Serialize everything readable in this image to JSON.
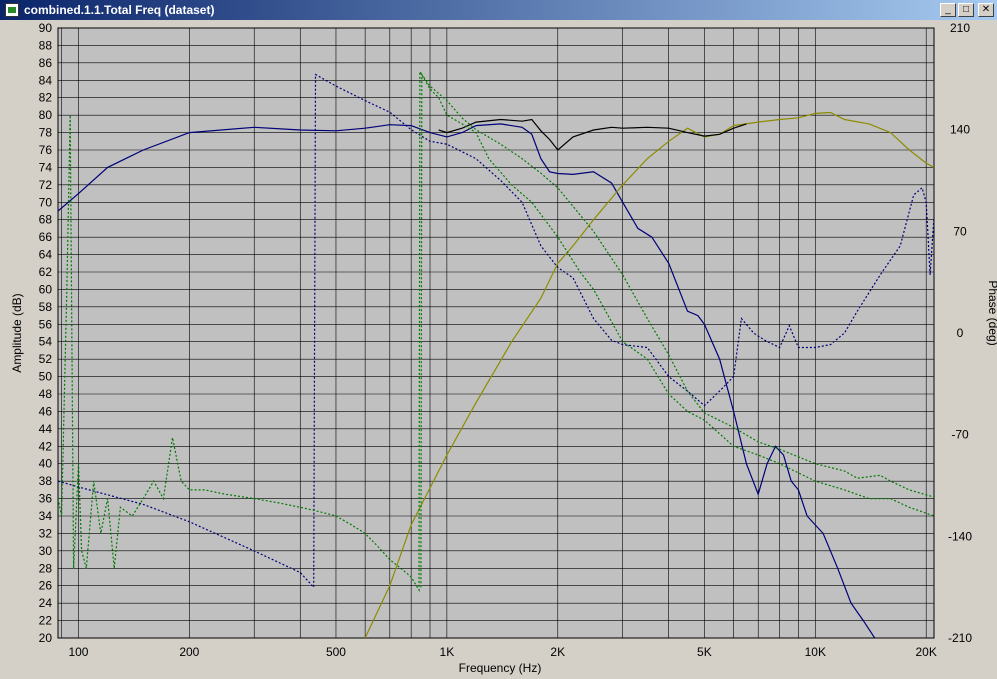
{
  "window": {
    "title": "combined.1.1.Total Freq (dataset)",
    "buttons": {
      "minimize": "_",
      "maximize": "□",
      "close": "✕"
    }
  },
  "colors": {
    "plot_bg": "#c0c0c0",
    "total_black": "#000000",
    "woofer_blue": "#00007a",
    "tweeter_olive": "#8c8c00",
    "sum_green": "#007a00"
  },
  "chart_data": {
    "type": "line",
    "title": "",
    "xlabel": "Frequency (Hz)",
    "ylabel": "Amplitude (dB)",
    "y2label": "Phase (deg)",
    "xscale": "log",
    "xlim": [
      88,
      21000
    ],
    "ylim": [
      20,
      90
    ],
    "y2lim": [
      -210,
      210
    ],
    "grid": true,
    "x_ticks": [
      {
        "v": 100,
        "label": "100"
      },
      {
        "v": 200,
        "label": "200"
      },
      {
        "v": 500,
        "label": "500"
      },
      {
        "v": 1000,
        "label": "1K"
      },
      {
        "v": 2000,
        "label": "2K"
      },
      {
        "v": 5000,
        "label": "5K"
      },
      {
        "v": 10000,
        "label": "10K"
      },
      {
        "v": 20000,
        "label": "20K"
      }
    ],
    "y_ticks": [
      "20",
      "22",
      "24",
      "26",
      "28",
      "30",
      "32",
      "34",
      "36",
      "38",
      "40",
      "42",
      "44",
      "46",
      "48",
      "50",
      "52",
      "54",
      "56",
      "58",
      "60",
      "62",
      "64",
      "66",
      "68",
      "70",
      "72",
      "74",
      "76",
      "78",
      "80",
      "82",
      "84",
      "86",
      "88",
      "90"
    ],
    "y2_ticks": [
      {
        "v": 210,
        "label": "210"
      },
      {
        "v": 140,
        "label": "140"
      },
      {
        "v": 70,
        "label": "70"
      },
      {
        "v": 0,
        "label": "0"
      },
      {
        "v": -70,
        "label": "-70"
      },
      {
        "v": -140,
        "label": "-140"
      },
      {
        "v": -210,
        "label": "-210"
      }
    ],
    "series": [
      {
        "key": "woofer_amp",
        "axis": "left",
        "color": "#00007a",
        "dash": false,
        "points": [
          [
            88,
            69
          ],
          [
            100,
            71
          ],
          [
            120,
            74
          ],
          [
            150,
            76
          ],
          [
            200,
            78
          ],
          [
            300,
            78.6
          ],
          [
            400,
            78.3
          ],
          [
            500,
            78.2
          ],
          [
            600,
            78.5
          ],
          [
            700,
            78.9
          ],
          [
            800,
            78.8
          ],
          [
            900,
            78
          ],
          [
            1000,
            77.5
          ],
          [
            1100,
            78
          ],
          [
            1200,
            78.8
          ],
          [
            1400,
            79
          ],
          [
            1600,
            78.6
          ],
          [
            1700,
            77.8
          ],
          [
            1800,
            75
          ],
          [
            1900,
            73.5
          ],
          [
            2000,
            73.3
          ],
          [
            2200,
            73.2
          ],
          [
            2500,
            73.5
          ],
          [
            2800,
            72.2
          ],
          [
            3000,
            70
          ],
          [
            3300,
            67
          ],
          [
            3600,
            66
          ],
          [
            4000,
            63
          ],
          [
            4500,
            57.5
          ],
          [
            4800,
            57
          ],
          [
            5000,
            56
          ],
          [
            5500,
            52
          ],
          [
            6000,
            46
          ],
          [
            6500,
            40
          ],
          [
            7000,
            36.5
          ],
          [
            7400,
            40
          ],
          [
            7800,
            42
          ],
          [
            8200,
            41
          ],
          [
            8600,
            38
          ],
          [
            9000,
            37
          ],
          [
            9500,
            34
          ],
          [
            10500,
            32
          ],
          [
            11500,
            28
          ],
          [
            12500,
            24
          ],
          [
            13500,
            22
          ],
          [
            14500,
            20
          ]
        ]
      },
      {
        "key": "woofer_phase",
        "axis": "right",
        "color": "#00007a",
        "dash": true,
        "points": [
          [
            88,
            -102
          ],
          [
            100,
            -106
          ],
          [
            150,
            -118
          ],
          [
            200,
            -130
          ],
          [
            300,
            -150
          ],
          [
            400,
            -165
          ],
          [
            435,
            -175
          ],
          [
            440,
            178
          ],
          [
            500,
            170
          ],
          [
            600,
            160
          ],
          [
            700,
            152
          ],
          [
            800,
            140
          ],
          [
            900,
            132
          ],
          [
            1000,
            130
          ],
          [
            1200,
            120
          ],
          [
            1400,
            105
          ],
          [
            1600,
            90
          ],
          [
            1800,
            60
          ],
          [
            2000,
            45
          ],
          [
            2200,
            38
          ],
          [
            2500,
            10
          ],
          [
            2800,
            -5
          ],
          [
            3000,
            -8
          ],
          [
            3500,
            -10
          ],
          [
            4000,
            -30
          ],
          [
            4500,
            -40
          ],
          [
            5000,
            -50
          ],
          [
            5500,
            -40
          ],
          [
            6000,
            -30
          ],
          [
            6300,
            10
          ],
          [
            6800,
            0
          ],
          [
            7300,
            -5
          ],
          [
            8000,
            -10
          ],
          [
            8500,
            5
          ],
          [
            9000,
            -10
          ],
          [
            10000,
            -10
          ],
          [
            11000,
            -8
          ],
          [
            12000,
            0
          ],
          [
            13000,
            15
          ],
          [
            15000,
            40
          ],
          [
            17000,
            60
          ],
          [
            18500,
            95
          ],
          [
            19500,
            100
          ],
          [
            20000,
            90
          ],
          [
            20500,
            40
          ],
          [
            21000,
            80
          ]
        ]
      },
      {
        "key": "tweeter_amp",
        "axis": "left",
        "color": "#8c8c00",
        "dash": false,
        "points": [
          [
            600,
            20
          ],
          [
            700,
            26
          ],
          [
            800,
            33
          ],
          [
            1000,
            41
          ],
          [
            1200,
            47
          ],
          [
            1500,
            54
          ],
          [
            1800,
            59
          ],
          [
            2000,
            63
          ],
          [
            2200,
            65
          ],
          [
            2500,
            68
          ],
          [
            3000,
            72
          ],
          [
            3500,
            75
          ],
          [
            4000,
            77
          ],
          [
            4500,
            78.5
          ],
          [
            5000,
            77.5
          ],
          [
            5500,
            77.8
          ],
          [
            6000,
            78.8
          ],
          [
            7000,
            79.2
          ],
          [
            8000,
            79.5
          ],
          [
            9000,
            79.7
          ],
          [
            10000,
            80.2
          ],
          [
            11000,
            80.3
          ],
          [
            12000,
            79.5
          ],
          [
            14000,
            79
          ],
          [
            16000,
            78
          ],
          [
            18000,
            76
          ],
          [
            20000,
            74.5
          ],
          [
            21000,
            74
          ]
        ]
      },
      {
        "key": "total_amp",
        "axis": "left",
        "color": "#000000",
        "dash": false,
        "points": [
          [
            950,
            78.3
          ],
          [
            1000,
            78
          ],
          [
            1100,
            78.5
          ],
          [
            1200,
            79.2
          ],
          [
            1400,
            79.5
          ],
          [
            1600,
            79.3
          ],
          [
            1700,
            79.5
          ],
          [
            1800,
            78.2
          ],
          [
            1900,
            77.2
          ],
          [
            2000,
            76
          ],
          [
            2200,
            77.5
          ],
          [
            2500,
            78.3
          ],
          [
            2800,
            78.6
          ],
          [
            3000,
            78.5
          ],
          [
            3500,
            78.6
          ],
          [
            4000,
            78.5
          ],
          [
            4500,
            78
          ],
          [
            5000,
            77.6
          ],
          [
            5500,
            77.8
          ],
          [
            6000,
            78.5
          ],
          [
            6500,
            79
          ]
        ]
      },
      {
        "key": "tweeter_phase",
        "axis": "right",
        "color": "#007a00",
        "dash": true,
        "points": [
          [
            850,
            -175
          ],
          [
            855,
            178
          ],
          [
            900,
            170
          ],
          [
            1000,
            160
          ],
          [
            1100,
            148
          ],
          [
            1200,
            140
          ],
          [
            1400,
            130
          ],
          [
            1600,
            120
          ],
          [
            1800,
            110
          ],
          [
            2000,
            100
          ],
          [
            2500,
            70
          ],
          [
            3000,
            40
          ],
          [
            3500,
            10
          ],
          [
            4000,
            -15
          ],
          [
            4500,
            -40
          ],
          [
            5000,
            -55
          ],
          [
            6000,
            -65
          ],
          [
            7000,
            -75
          ],
          [
            8000,
            -80
          ],
          [
            10000,
            -90
          ],
          [
            12000,
            -95
          ],
          [
            13000,
            -100
          ],
          [
            15000,
            -98
          ],
          [
            16000,
            -102
          ],
          [
            18000,
            -108
          ],
          [
            21000,
            -113
          ]
        ]
      },
      {
        "key": "sum_amp",
        "axis": "left",
        "color": "#007a00",
        "dash": true,
        "points": [
          [
            88,
            36
          ],
          [
            90,
            34
          ],
          [
            93,
            60
          ],
          [
            95,
            80
          ],
          [
            97,
            28
          ],
          [
            100,
            40
          ],
          [
            102,
            30
          ],
          [
            105,
            28
          ],
          [
            110,
            38
          ],
          [
            115,
            32
          ],
          [
            120,
            36
          ],
          [
            125,
            28
          ],
          [
            130,
            35
          ],
          [
            140,
            34
          ],
          [
            150,
            36
          ],
          [
            160,
            38
          ],
          [
            170,
            36
          ],
          [
            180,
            43
          ],
          [
            190,
            38
          ],
          [
            200,
            37
          ],
          [
            220,
            37
          ],
          [
            250,
            36.5
          ],
          [
            300,
            36
          ],
          [
            350,
            35.5
          ],
          [
            400,
            35
          ],
          [
            450,
            34.5
          ],
          [
            500,
            34
          ],
          [
            550,
            33
          ],
          [
            600,
            32
          ],
          [
            650,
            30.5
          ],
          [
            700,
            29
          ],
          [
            750,
            28
          ],
          [
            800,
            27
          ],
          [
            840,
            25.5
          ],
          [
            845,
            85
          ],
          [
            900,
            83
          ],
          [
            950,
            82
          ],
          [
            1000,
            80
          ],
          [
            1100,
            79
          ],
          [
            1200,
            78
          ],
          [
            1300,
            75
          ],
          [
            1500,
            72
          ],
          [
            1700,
            70
          ],
          [
            2000,
            66
          ],
          [
            2300,
            62
          ],
          [
            2500,
            60
          ],
          [
            3000,
            54
          ],
          [
            3500,
            52
          ],
          [
            4000,
            48
          ],
          [
            4500,
            46
          ],
          [
            5000,
            45
          ],
          [
            6000,
            42
          ],
          [
            7000,
            41
          ],
          [
            8000,
            40
          ],
          [
            10000,
            38
          ],
          [
            12000,
            37
          ],
          [
            14000,
            36
          ],
          [
            16000,
            36
          ],
          [
            18000,
            35
          ],
          [
            21000,
            34
          ]
        ]
      }
    ]
  }
}
